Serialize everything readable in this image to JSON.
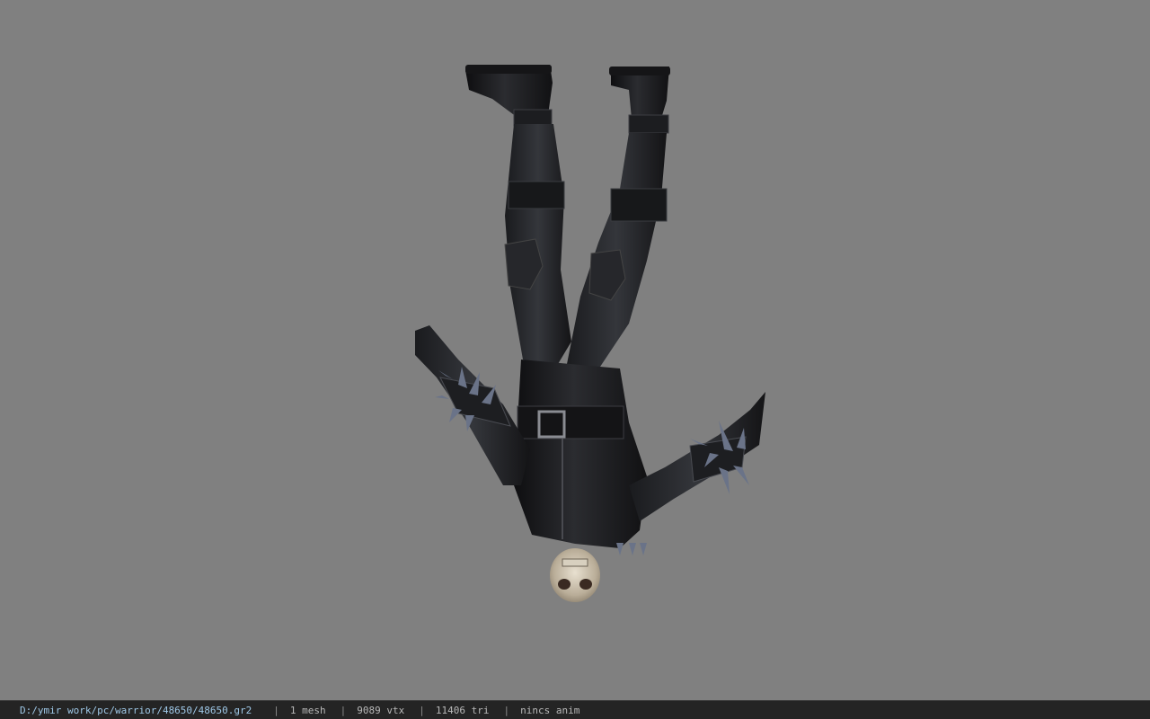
{
  "viewer": {
    "background_color": "#808080",
    "model_orientation": "upside-down",
    "model_description_icon": "warrior-model-icon"
  },
  "status": {
    "file_path": "D:/ymir work/pc/warrior/48650/48650.gr2",
    "separator": "|",
    "mesh_count": "1 mesh",
    "vertex_count": "9089 vtx",
    "triangle_count": "11406 tri",
    "anim": "nincs anim"
  }
}
